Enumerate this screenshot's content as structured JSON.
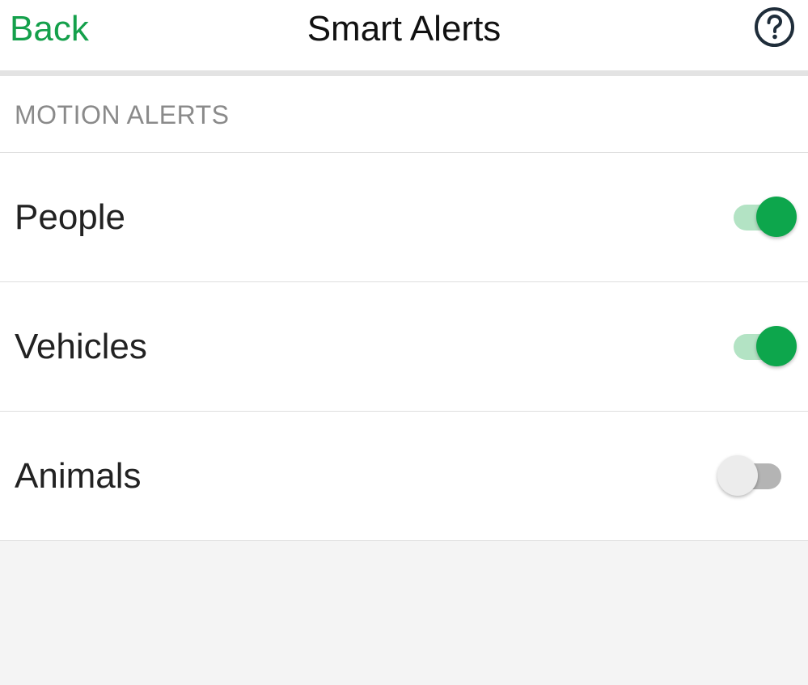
{
  "header": {
    "back_label": "Back",
    "title": "Smart Alerts",
    "help_icon": "question-circle-icon"
  },
  "section": {
    "title": "MOTION ALERTS"
  },
  "alerts": [
    {
      "label": "People",
      "enabled": true
    },
    {
      "label": "Vehicles",
      "enabled": true
    },
    {
      "label": "Animals",
      "enabled": false
    }
  ],
  "colors": {
    "accent": "#14a04b",
    "toggle_on_thumb": "#0da64c",
    "toggle_on_track": "#b3e3c4",
    "toggle_off_thumb": "#ececec",
    "toggle_off_track": "#b4b4b4"
  }
}
